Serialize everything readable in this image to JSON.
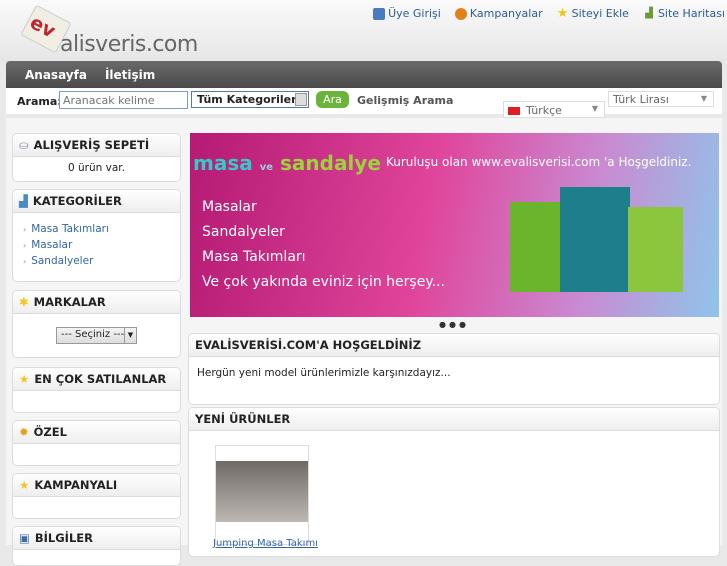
{
  "logo": {
    "ev": "ev",
    "text": "alisveris.com"
  },
  "toplinks": [
    {
      "label": "Üye Girişi",
      "icon": "users-icon",
      "color": "#4a7bbf"
    },
    {
      "label": "Kampanyalar",
      "icon": "coin-icon",
      "color": "#e0821c"
    },
    {
      "label": "Siteyi Ekle",
      "icon": "star-icon",
      "color": "#f3c21a"
    },
    {
      "label": "Site Haritası",
      "icon": "sitemap-icon",
      "color": "#6b9a3a"
    }
  ],
  "nav": [
    "Anasayfa",
    "İletişim"
  ],
  "search": {
    "label": "Arama:",
    "placeholder": "Aranacak kelime",
    "category": "Tüm Kategoriler",
    "button": "Ara",
    "advanced": "Gelişmiş Arama"
  },
  "language": "Türkçe",
  "currency": "Türk Lirası",
  "cart": {
    "title": "ALIŞVERİŞ SEPETİ",
    "text": "0 ürün var."
  },
  "categories": {
    "title": "KATEGORİLER",
    "items": [
      "Masa Takımları",
      "Masalar",
      "Sandalyeler"
    ]
  },
  "brands": {
    "title": "MARKALAR",
    "select": "--- Seçiniz ---"
  },
  "bestsellers": {
    "title": "EN ÇOK SATILANLAR"
  },
  "special": {
    "title": "ÖZEL"
  },
  "campaign": {
    "title": "KAMPANYALI"
  },
  "info": {
    "title": "BİLGİLER"
  },
  "banner": {
    "logo_a": "masa",
    "logo_b": "sandalye",
    "top": "Kuruluşu olan www.evalisverisi.com 'a Hoşgeldiniz.",
    "lines": [
      "Masalar",
      "Sandalyeler",
      "Masa Takımları",
      "Ve çok yakında eviniz için herşey..."
    ],
    "slides": 3
  },
  "welcome": {
    "title": "EVALİSVERİSİ.COM'A HOŞGELDİNİZ",
    "text": "Hergün yeni model ürünlerimizle karşınızdayız..."
  },
  "newproducts": {
    "title": "YENİ ÜRÜNLER",
    "items": [
      {
        "name": "Jumping Masa Takımı"
      }
    ]
  }
}
